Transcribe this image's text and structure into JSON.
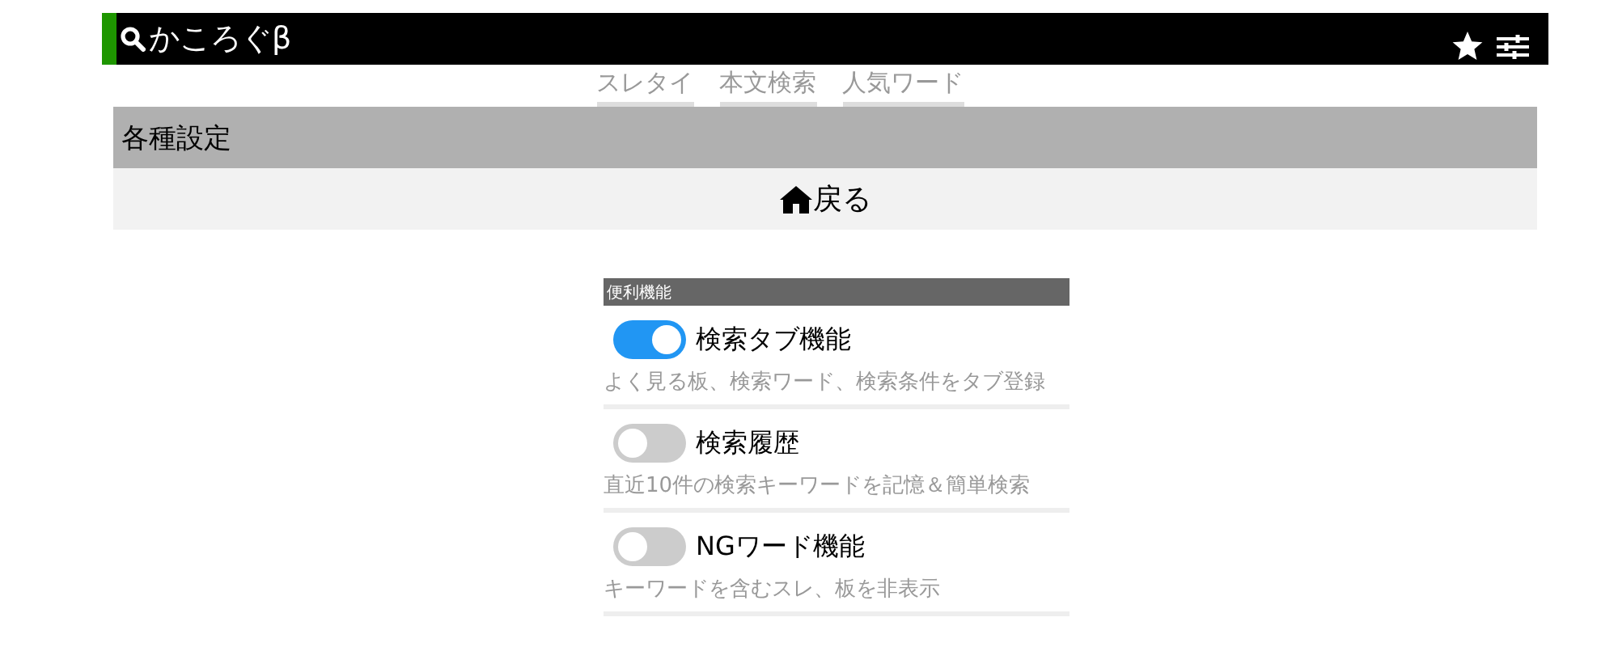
{
  "header": {
    "title": "かころぐβ"
  },
  "nav_tabs": [
    {
      "label": "スレタイ"
    },
    {
      "label": "本文検索"
    },
    {
      "label": "人気ワード"
    }
  ],
  "page_title": "各種設定",
  "back_button": {
    "label": "戻る"
  },
  "settings_section": {
    "title": "便利機能",
    "items": [
      {
        "label": "検索タブ機能",
        "description": "よく見る板、検索ワード、検索条件をタブ登録",
        "on": true
      },
      {
        "label": "検索履歴",
        "description": "直近10件の検索キーワードを記憶＆簡単検索",
        "on": false
      },
      {
        "label": "NGワード機能",
        "description": "キーワードを含むスレ、板を非表示",
        "on": false
      }
    ]
  }
}
